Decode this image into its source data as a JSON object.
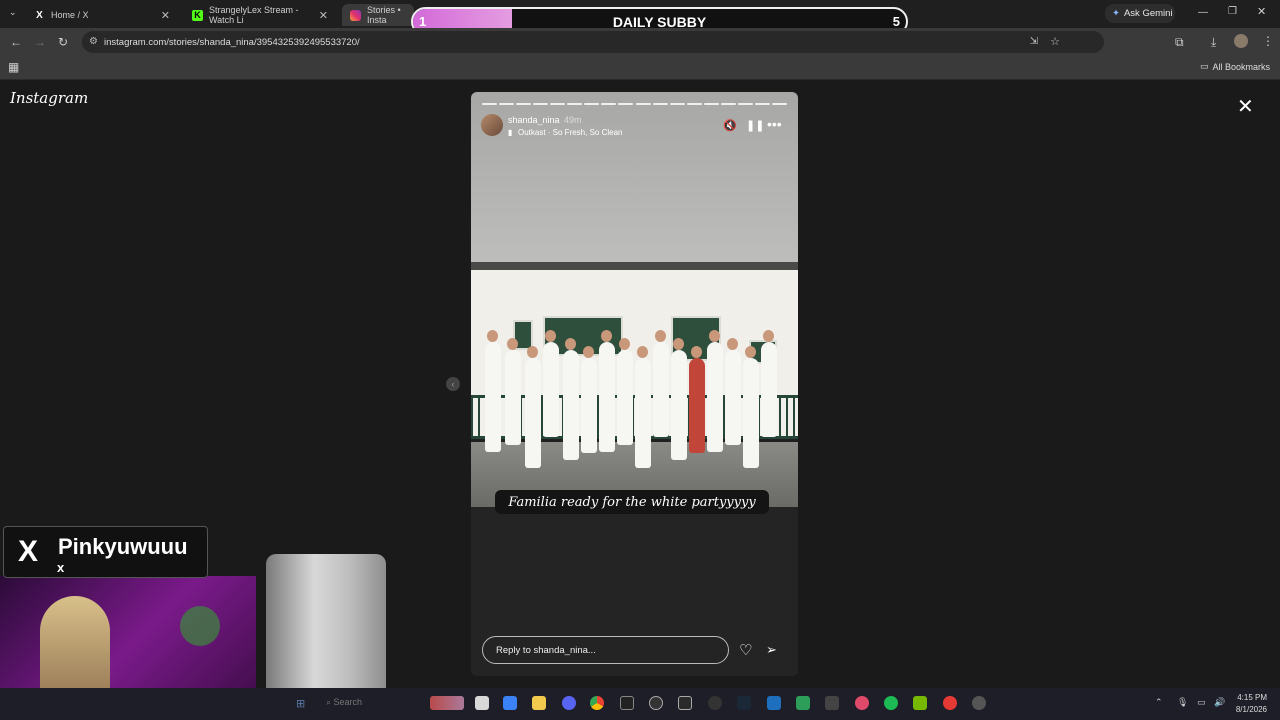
{
  "browser": {
    "tabs": [
      {
        "label": "Home / X",
        "fav_color": "#ffffff"
      },
      {
        "label": "StrangelyLex Stream - Watch Li",
        "fav_color": "#53fc18"
      },
      {
        "label": "Stories • Insta",
        "fav_color": "#e1306c"
      }
    ],
    "ask_gemini": "Ask Gemini",
    "url": "instagram.com/stories/shanda_nina/3954325392495533720/",
    "all_bookmarks": "All Bookmarks"
  },
  "overlay": {
    "left_number": "1",
    "title": "DAILY SUBBY",
    "right_number": "5",
    "fill_fraction": 0.2
  },
  "instagram": {
    "logo": "Instagram"
  },
  "story": {
    "username": "shanda_nina",
    "time": "49m",
    "music": "Outkast · So Fresh, So Clean",
    "caption": "Familia ready for the white partyyyyy",
    "reply_placeholder": "Reply to shanda_nina...",
    "progress_segments": 18,
    "progress_current": 18
  },
  "stream": {
    "x_name": "Pinkyuwuuu",
    "x_sub": "x"
  },
  "taskbar": {
    "search_placeholder": "Search",
    "time": "4:15 PM",
    "date": "8/1/2026"
  },
  "colors": {
    "accent": "#e59ce0",
    "page_bg": "#1a1a1a"
  }
}
